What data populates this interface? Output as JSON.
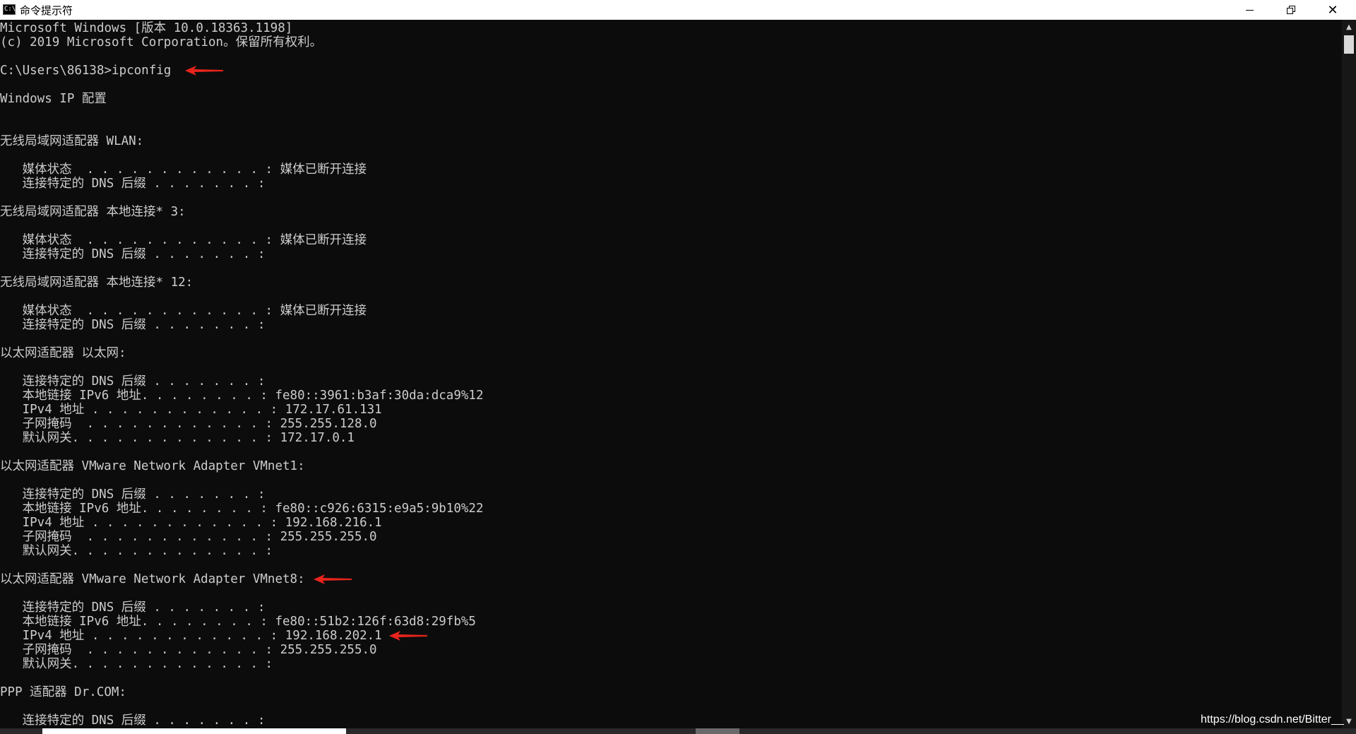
{
  "window": {
    "title": "命令提示符",
    "icon_name": "cmd-icon",
    "icon_text": "C:\\"
  },
  "console": {
    "lines": [
      "Microsoft Windows [版本 10.0.18363.1198]",
      "(c) 2019 Microsoft Corporation。保留所有权利。",
      "",
      "C:\\Users\\86138>ipconfig",
      "",
      "Windows IP 配置",
      "",
      "",
      "无线局域网适配器 WLAN:",
      "",
      "   媒体状态  . . . . . . . . . . . . : 媒体已断开连接",
      "   连接特定的 DNS 后缀 . . . . . . . :",
      "",
      "无线局域网适配器 本地连接* 3:",
      "",
      "   媒体状态  . . . . . . . . . . . . : 媒体已断开连接",
      "   连接特定的 DNS 后缀 . . . . . . . :",
      "",
      "无线局域网适配器 本地连接* 12:",
      "",
      "   媒体状态  . . . . . . . . . . . . : 媒体已断开连接",
      "   连接特定的 DNS 后缀 . . . . . . . :",
      "",
      "以太网适配器 以太网:",
      "",
      "   连接特定的 DNS 后缀 . . . . . . . :",
      "   本地链接 IPv6 地址. . . . . . . . : fe80::3961:b3af:30da:dca9%12",
      "   IPv4 地址 . . . . . . . . . . . . : 172.17.61.131",
      "   子网掩码  . . . . . . . . . . . . : 255.255.128.0",
      "   默认网关. . . . . . . . . . . . . : 172.17.0.1",
      "",
      "以太网适配器 VMware Network Adapter VMnet1:",
      "",
      "   连接特定的 DNS 后缀 . . . . . . . :",
      "   本地链接 IPv6 地址. . . . . . . . : fe80::c926:6315:e9a5:9b10%22",
      "   IPv4 地址 . . . . . . . . . . . . : 192.168.216.1",
      "   子网掩码  . . . . . . . . . . . . : 255.255.255.0",
      "   默认网关. . . . . . . . . . . . . :",
      "",
      "以太网适配器 VMware Network Adapter VMnet8:",
      "",
      "   连接特定的 DNS 后缀 . . . . . . . :",
      "   本地链接 IPv6 地址. . . . . . . . : fe80::51b2:126f:63d8:29fb%5",
      "   IPv4 地址 . . . . . . . . . . . . : 192.168.202.1",
      "   子网掩码  . . . . . . . . . . . . : 255.255.255.0",
      "   默认网关. . . . . . . . . . . . . :",
      "",
      "PPP 适配器 Dr.COM:",
      "",
      "   连接特定的 DNS 后缀 . . . . . . . :"
    ],
    "text_color": "#cccccc",
    "background": "#0c0c0c"
  },
  "annotations": {
    "arrow_color": "#e8241c",
    "arrow_lines": [
      3,
      39,
      43
    ]
  },
  "watermark": "https://blog.csdn.net/Bitter__"
}
